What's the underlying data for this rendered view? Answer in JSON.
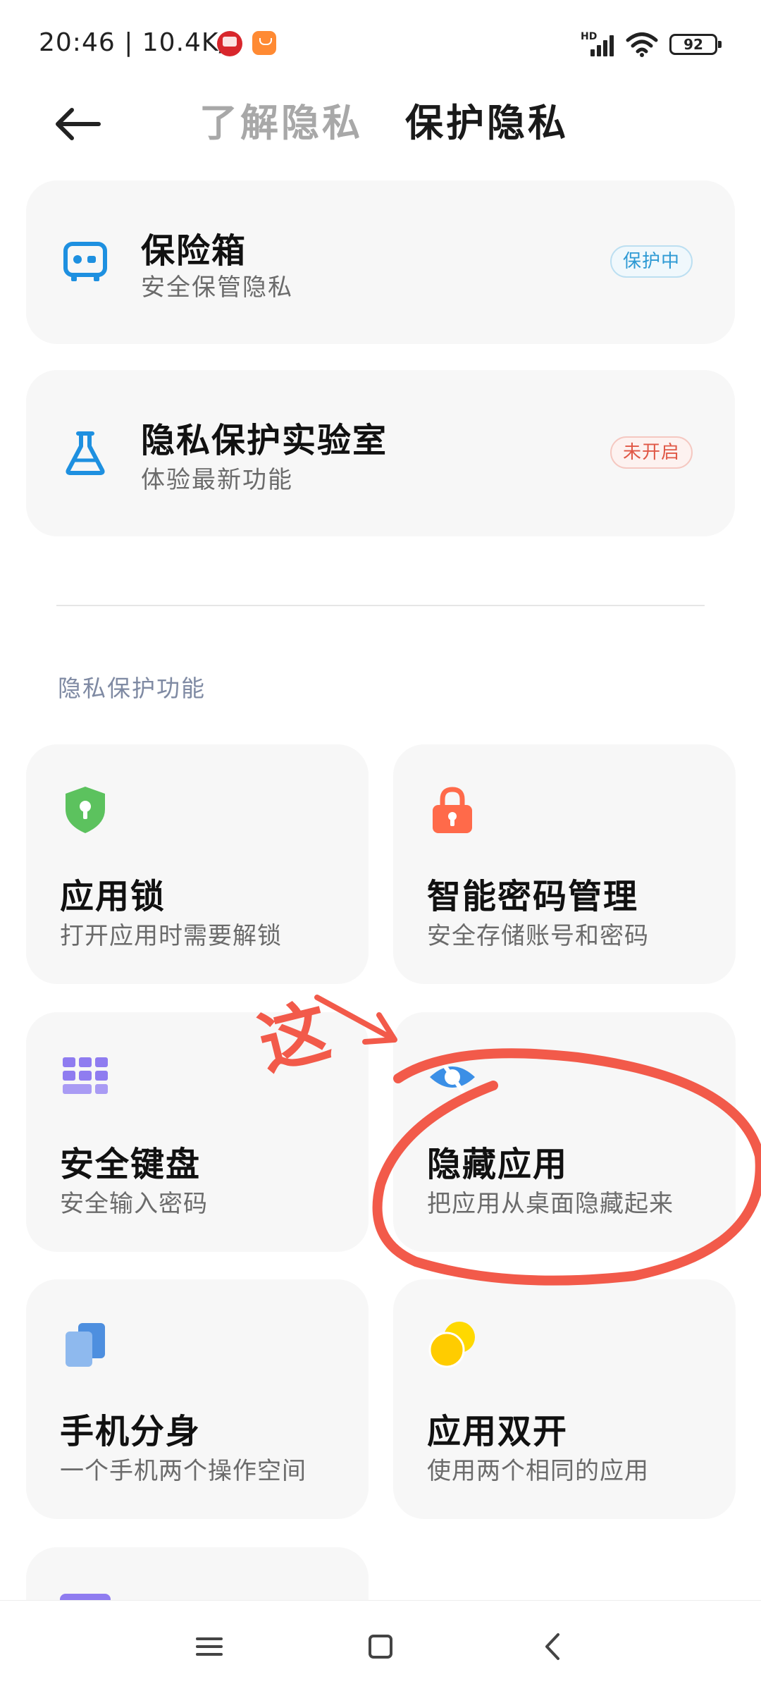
{
  "status_bar": {
    "time": "20:46 | 10.4K/s",
    "network": "HD",
    "battery": "92"
  },
  "header": {
    "tabs": [
      {
        "label": "了解隐私",
        "active": false
      },
      {
        "label": "保护隐私",
        "active": true
      }
    ]
  },
  "cards": {
    "vault": {
      "title": "保险箱",
      "subtitle": "安全保管隐私",
      "badge": "保护中",
      "icon": "safe-icon"
    },
    "lab": {
      "title": "隐私保护实验室",
      "subtitle": "体验最新功能",
      "badge": "未开启",
      "icon": "flask-icon"
    }
  },
  "section": {
    "label": "隐私保护功能"
  },
  "features": [
    {
      "title": "应用锁",
      "subtitle": "打开应用时需要解锁",
      "icon": "shield-lock-icon",
      "color": "#5cc25e"
    },
    {
      "title": "智能密码管理",
      "subtitle": "安全存储账号和密码",
      "icon": "padlock-icon",
      "color": "#ff6a4a"
    },
    {
      "title": "安全键盘",
      "subtitle": "安全输入密码",
      "icon": "keyboard-grid-icon",
      "color": "#8f7cf0"
    },
    {
      "title": "隐藏应用",
      "subtitle": "把应用从桌面隐藏起来",
      "icon": "eye-hidden-icon",
      "color": "#3b8fe6"
    },
    {
      "title": "手机分身",
      "subtitle": "一个手机两个操作空间",
      "icon": "dual-phone-icon",
      "color": "#4e8fdf"
    },
    {
      "title": "应用双开",
      "subtitle": "使用两个相同的应用",
      "icon": "dual-circle-icon",
      "color": "#ffcc00"
    }
  ],
  "annotation": {
    "text": "这",
    "color": "#f25a4a"
  },
  "nav": {
    "menu": "menu-icon",
    "home": "home-icon",
    "back": "back-icon"
  }
}
